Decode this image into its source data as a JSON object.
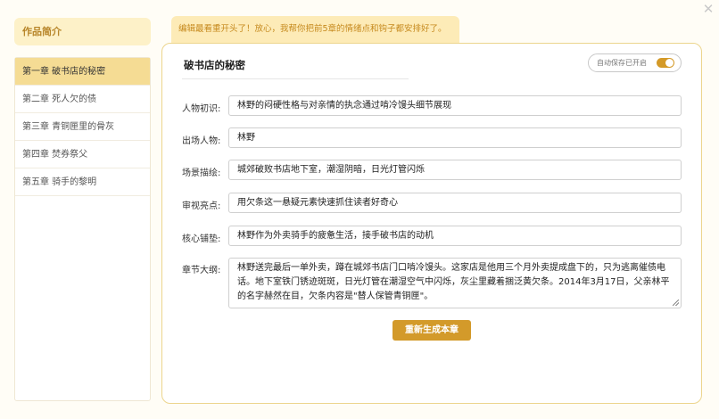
{
  "close_icon": "✕",
  "sidebar": {
    "intro_label": "作品简介",
    "chapters": [
      {
        "label": "第一章 破书店的秘密",
        "active": true
      },
      {
        "label": "第二章 死人欠的债",
        "active": false
      },
      {
        "label": "第三章 青铜匣里的骨灰",
        "active": false
      },
      {
        "label": "第四章 焚券祭父",
        "active": false
      },
      {
        "label": "第五章 骑手的黎明",
        "active": false
      }
    ]
  },
  "banner": {
    "text": "编辑最看重开头了！放心，我帮你把前5章的情绪点和钩子都安排好了。"
  },
  "main": {
    "title": "破书店的秘密",
    "autosave_label": "自动保存已开启",
    "fields": {
      "character_label": "人物初识:",
      "character_value": "林野的闷硬性格与对亲情的执念通过啃冷馒头细节展现",
      "cast_label": "出场人物:",
      "cast_value": "林野",
      "scene_label": "场景描绘:",
      "scene_value": "城郊破败书店地下室，潮湿阴暗，日光灯管闪烁",
      "hook_label": "审视亮点:",
      "hook_value": "用欠条这一悬疑元素快速抓住读者好奇心",
      "setup_label": "核心铺垫:",
      "setup_value": "林野作为外卖骑手的疲惫生活，接手破书店的动机",
      "outline_label": "章节大纲:",
      "outline_value": "林野送完最后一单外卖，蹲在城郊书店门口啃冷馒头。这家店是他用三个月外卖提成盘下的，只为逃离催债电话。地下室铁门锈迹斑斑，日光灯管在潮湿空气中闪烁，灰尘里藏着捆泛黄欠条。2014年3月17日，父亲林平的名字赫然在目，欠条内容是\"替人保管青铜匣\"。"
    },
    "regen_label": "重新生成本章"
  },
  "colors": {
    "accent": "#d39a2a",
    "active_bg": "#f5dc94",
    "banner_bg": "#fdebb7",
    "panel_border": "#ecd58d"
  }
}
